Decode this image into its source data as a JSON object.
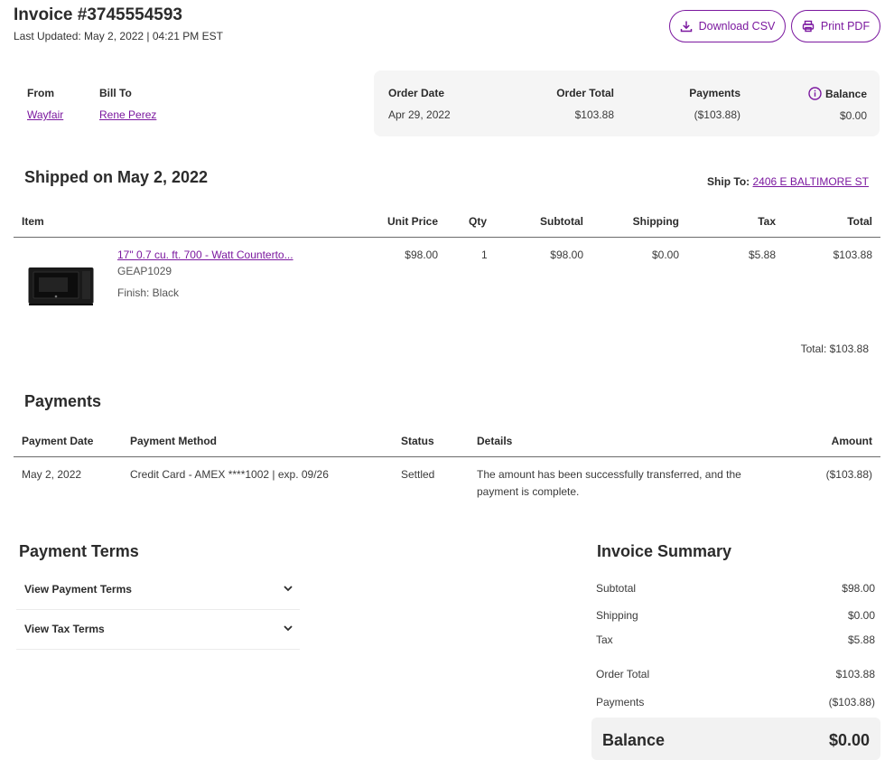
{
  "header": {
    "title": "Invoice #3745554593",
    "last_updated": "Last Updated: May 2, 2022 | 04:21 PM EST",
    "download_csv": "Download CSV",
    "print_pdf": "Print PDF"
  },
  "parties": {
    "from_label": "From",
    "from_value": "Wayfair",
    "bill_to_label": "Bill To",
    "bill_to_value": "Rene Perez"
  },
  "order_summary": {
    "order_date_label": "Order Date",
    "order_date": "Apr 29, 2022",
    "order_total_label": "Order Total",
    "order_total": "$103.88",
    "payments_label": "Payments",
    "payments": "($103.88)",
    "balance_label": "Balance",
    "balance": "$0.00"
  },
  "shipment": {
    "title": "Shipped on May 2, 2022",
    "ship_to_label": "Ship To:",
    "ship_to_value": "2406 E BALTIMORE ST",
    "columns": [
      "Item",
      "Unit Price",
      "Qty",
      "Subtotal",
      "Shipping",
      "Tax",
      "Total"
    ],
    "item": {
      "name": "17\" 0.7 cu. ft. 700 - Watt Counterto...",
      "sku": "GEAP1029",
      "finish": "Finish: Black",
      "unit_price": "$98.00",
      "qty": "1",
      "subtotal": "$98.00",
      "shipping": "$0.00",
      "tax": "$5.88",
      "total": "$103.88"
    },
    "total_line": "Total: $103.88"
  },
  "payments": {
    "title": "Payments",
    "columns": [
      "Payment Date",
      "Payment Method",
      "Status",
      "Details",
      "Amount"
    ],
    "row": {
      "date": "May 2, 2022",
      "method": "Credit Card - AMEX ****1002 | exp. 09/26",
      "status": "Settled",
      "details_line1": "The amount has been successfully transferred, and the",
      "details_line2": "payment is complete.",
      "amount": "($103.88)"
    }
  },
  "payment_terms": {
    "title": "Payment Terms",
    "view_payment_terms": "View Payment Terms",
    "view_tax_terms": "View Tax Terms"
  },
  "invoice_summary": {
    "title": "Invoice Summary",
    "subtotal_label": "Subtotal",
    "subtotal": "$98.00",
    "shipping_label": "Shipping",
    "shipping": "$0.00",
    "tax_label": "Tax",
    "tax": "$5.88",
    "order_total_label": "Order Total",
    "order_total": "$103.88",
    "payments_label": "Payments",
    "payments": "($103.88)",
    "balance_label": "Balance",
    "balance": "$0.00"
  },
  "colors": {
    "accent": "#7b189f",
    "panel_bg": "#f5f5f5"
  }
}
